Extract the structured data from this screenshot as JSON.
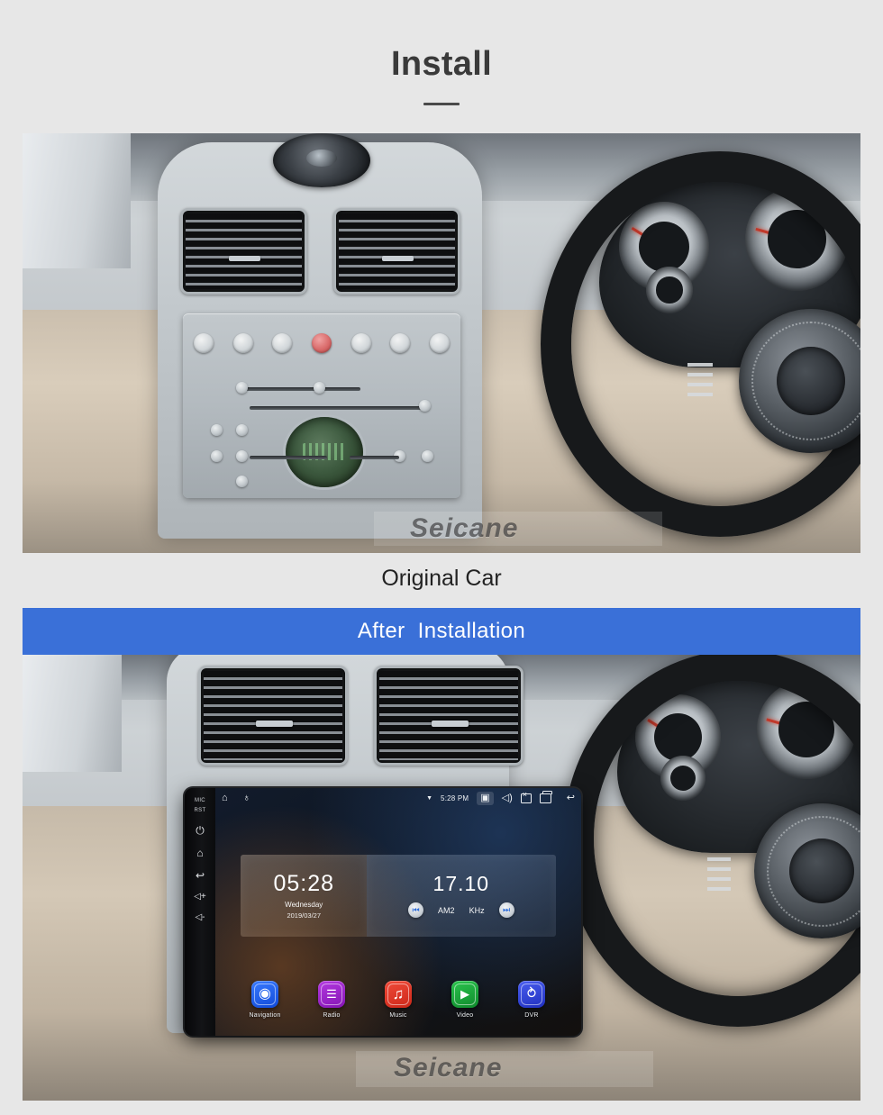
{
  "header": {
    "title": "Install"
  },
  "sections": {
    "original": {
      "caption": "Original Car",
      "watermark": "Seicane"
    },
    "after": {
      "banner_label": "After  Installation",
      "banner_color": "#3a70d8",
      "watermark": "Seicane"
    }
  },
  "head_unit": {
    "bezel": {
      "mic_label": "MIC",
      "reset_label": "RST",
      "power_icon": "⏻",
      "home_icon": "⌂",
      "back_icon": "↩",
      "volume_up_icon": "◁+",
      "volume_down_icon": "◁-"
    },
    "status_bar": {
      "home_icon": "⌂",
      "mic_icon": "♁",
      "wifi_icon": "▼",
      "clock": "5:28 PM",
      "camera_icon": "▣",
      "volume_icon": "◁)",
      "close_label": "×",
      "recents_label": "",
      "back_icon": "↩"
    },
    "clock_widget": {
      "time": "05:28",
      "weekday": "Wednesday",
      "date": "2019/03/27"
    },
    "radio_widget": {
      "frequency": "17.10",
      "band": "AM2",
      "unit": "KHz",
      "prev_icon": "⏮",
      "next_icon": "⏭"
    },
    "apps": [
      {
        "label": "Navigation",
        "glyph": "◉",
        "color": "#1a5ff0"
      },
      {
        "label": "Radio",
        "glyph": "☰",
        "color": "#9b20c8"
      },
      {
        "label": "Music",
        "glyph": "♫",
        "color": "#e0392b"
      },
      {
        "label": "Video",
        "glyph": "▶",
        "color": "#1aa33c"
      },
      {
        "label": "DVR",
        "glyph": "⥁",
        "color": "#2a46d8"
      }
    ]
  }
}
